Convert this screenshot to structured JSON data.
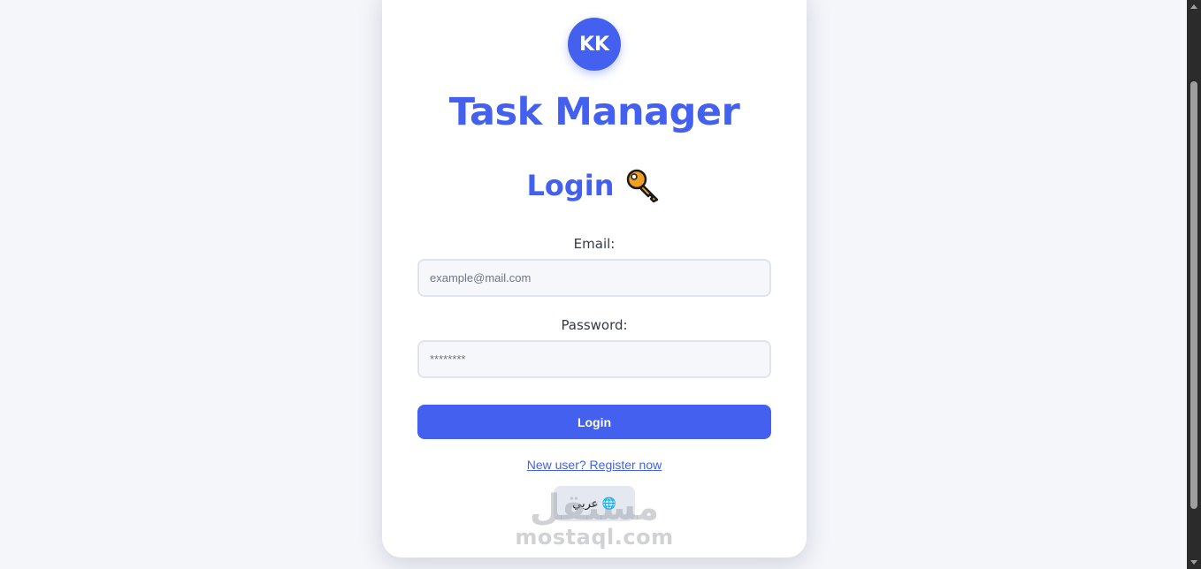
{
  "app": {
    "logo_initials": "KK",
    "title": "Task Manager"
  },
  "form": {
    "heading": "Login",
    "heading_icon": "key-icon",
    "email_label": "Email:",
    "email_placeholder": "example@mail.com",
    "email_value": "",
    "password_label": "Password:",
    "password_placeholder": "********",
    "password_value": "",
    "submit_label": "Login",
    "register_link": "New user? Register now",
    "language_button": "عربي 🌐",
    "language_icon": "globe-icon"
  },
  "watermark": {
    "arabic": "مستقل",
    "latin": "mostaql.com"
  },
  "colors": {
    "accent": "#4361ee",
    "page_background": "#f4f6fa",
    "card_background": "#ffffff",
    "input_background": "#f5f7fb",
    "input_border": "#dfe4ee",
    "language_button_background": "#e3e8f1",
    "scrollbar": "#2b2b2b"
  }
}
